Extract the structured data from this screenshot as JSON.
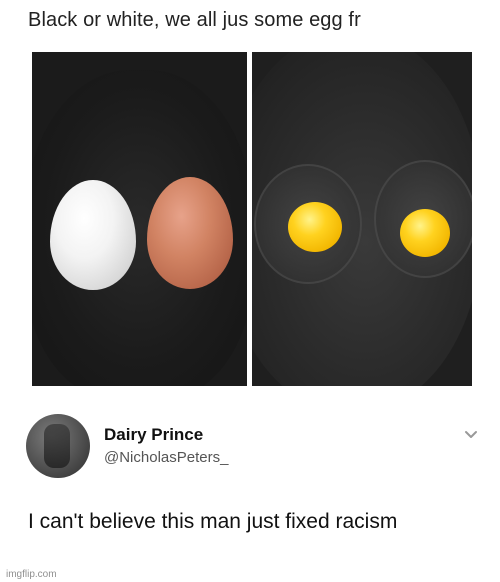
{
  "post": {
    "caption": "Black or white, we all jus some egg fr"
  },
  "tweet": {
    "display_name": "Dairy Prince",
    "handle": "@NicholasPeters_",
    "text": "I can't believe this man just fixed racism"
  },
  "watermark": "imgflip.com",
  "icons": {
    "menu": "chevron-down-icon"
  }
}
